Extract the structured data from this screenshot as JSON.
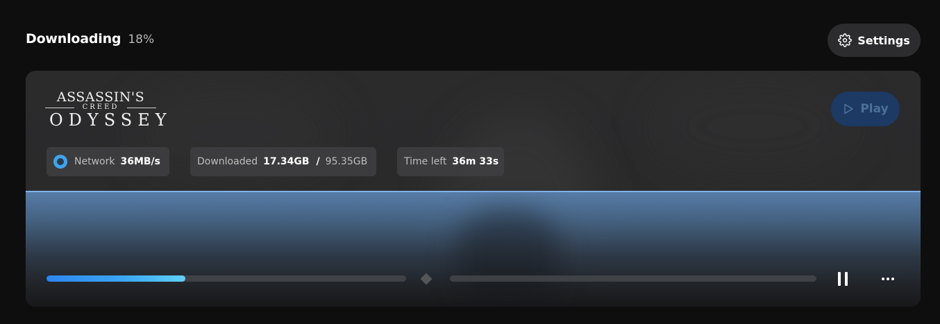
{
  "header": {
    "title": "Downloading",
    "percent_text": "18%"
  },
  "settings": {
    "label": "Settings",
    "icon": "gear-icon"
  },
  "game": {
    "logo_line1": "ASSASSIN'S",
    "logo_line2": "CREED",
    "logo_line3": "ODYSSEY"
  },
  "play": {
    "label": "Play",
    "icon": "play-icon",
    "enabled": false
  },
  "stats": {
    "network_label": "Network",
    "network_value": "36MB/s",
    "downloaded_label": "Downloaded",
    "downloaded_value": "17.34GB",
    "downloaded_separator": "/",
    "downloaded_total": "95.35GB",
    "time_label": "Time left",
    "time_value": "36m 33s"
  },
  "progress": {
    "percent": 18
  },
  "colors": {
    "accent": "#3aa6f2",
    "play_bg": "#1c3a63",
    "band_top": "#7fb3ea"
  }
}
